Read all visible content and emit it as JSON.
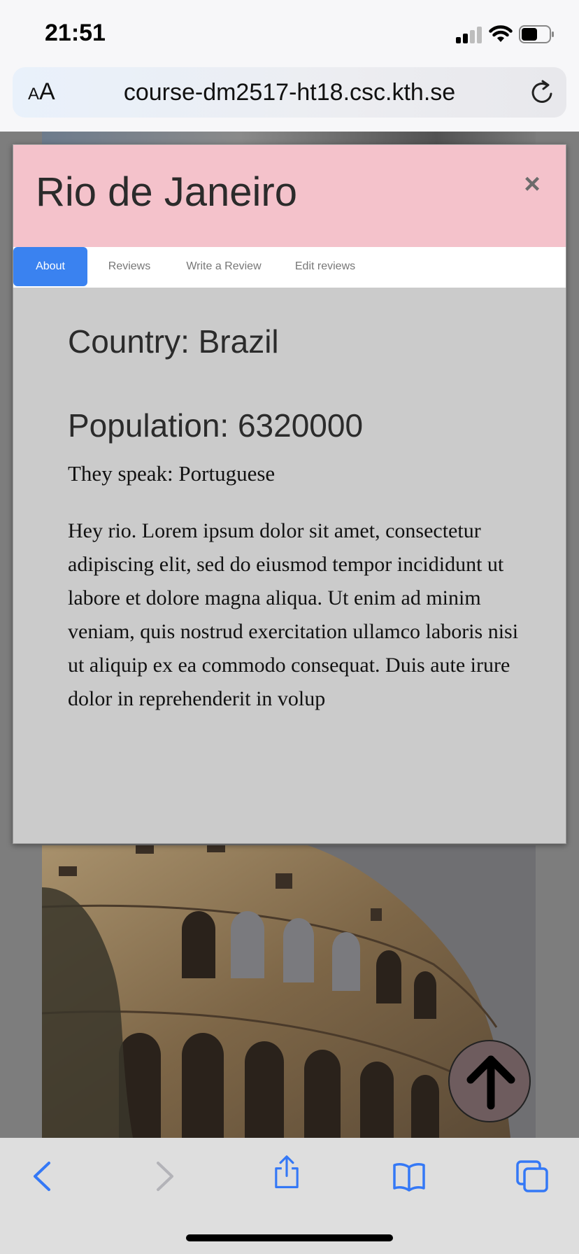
{
  "status_bar": {
    "time": "21:51"
  },
  "browser": {
    "text_size_button": {
      "small": "A",
      "large": "A"
    },
    "url": "course-dm2517-ht18.csc.kth.se"
  },
  "modal": {
    "title": "Rio de Janeiro",
    "close_label": "×",
    "tabs": [
      {
        "label": "About",
        "active": true
      },
      {
        "label": "Reviews",
        "active": false
      },
      {
        "label": "Write a Review",
        "active": false
      },
      {
        "label": "Edit reviews",
        "active": false
      }
    ],
    "country": "Country: Brazil",
    "population": "Population: 6320000",
    "language": "They speak: Portuguese",
    "description": "Hey rio. Lorem ipsum dolor sit amet, consectetur adipiscing elit, sed do eiusmod tempor incididunt ut labore et dolore magna aliqua. Ut enim ad minim veniam, quis nostrud exercitation ullamco laboris nisi ut aliquip ex ea commodo consequat. Duis aute irure dolor in reprehenderit in volup"
  },
  "colors": {
    "modal_header": "#f4c2cb",
    "modal_body": "#cbcbcb",
    "active_tab": "#3a82f0",
    "toolbar_icon": "#3478f6"
  },
  "icons": {
    "status": [
      "cellular-signal-icon",
      "wifi-icon",
      "battery-icon"
    ],
    "browser": [
      "reload-icon"
    ],
    "toolbar": [
      "back-icon",
      "forward-icon",
      "share-icon",
      "bookmarks-icon",
      "tabs-icon"
    ],
    "page": [
      "arrow-up-icon"
    ]
  }
}
